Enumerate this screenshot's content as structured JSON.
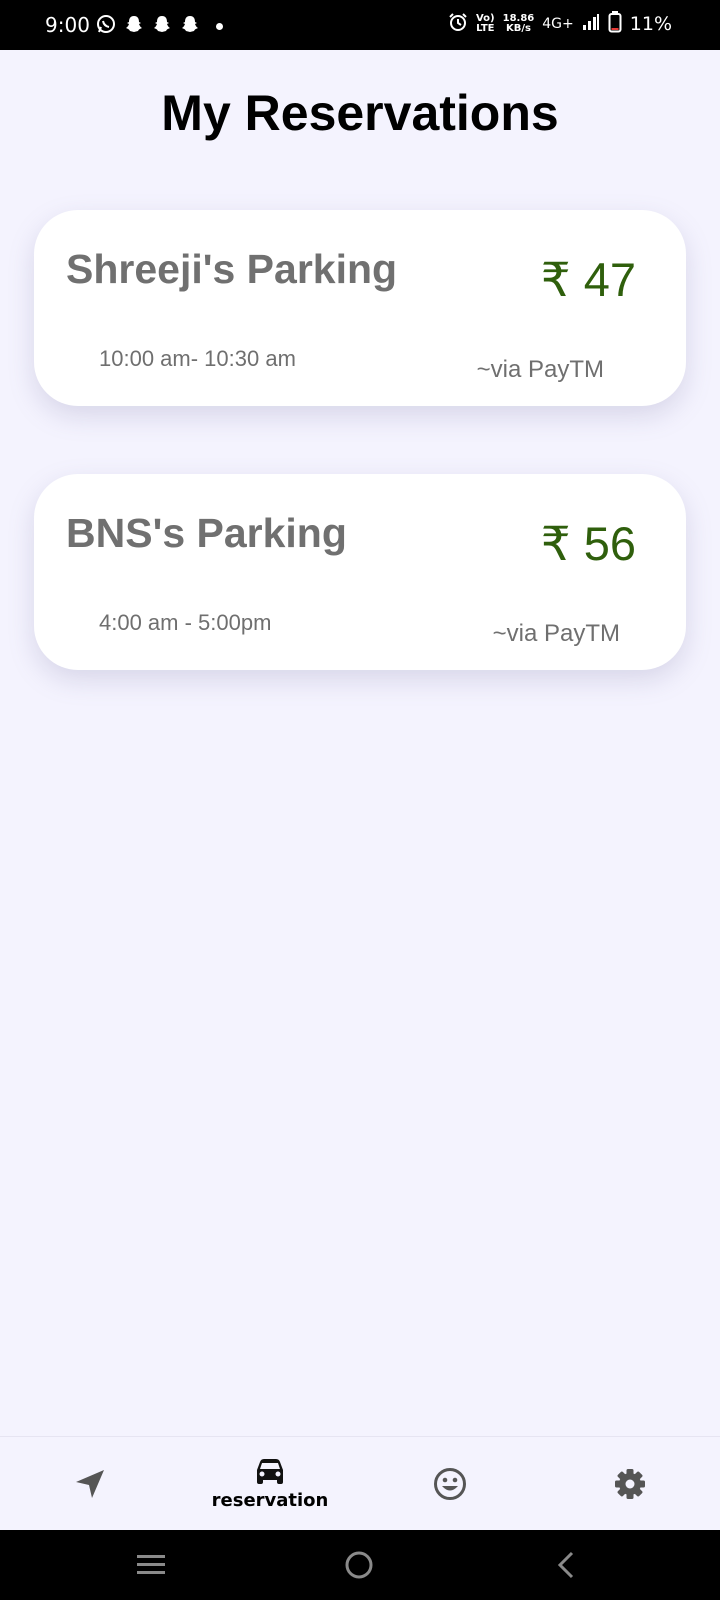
{
  "status_bar": {
    "time": "9:00",
    "network_top": "Vo)",
    "network_bottom": "LTE",
    "speed_value": "18.86",
    "speed_unit": "KB/s",
    "network_type": "4G+",
    "battery_percent": "11%"
  },
  "page": {
    "title": "My Reservations"
  },
  "reservations": [
    {
      "name": "Shreeji's Parking",
      "price": "₹ 47",
      "time": "10:00 am- 10:30 am",
      "payment": "~via PayTM"
    },
    {
      "name": "BNS's Parking",
      "price": "₹ 56",
      "time": "4:00 am - 5:00pm",
      "payment": "~via PayTM"
    }
  ],
  "bottom_nav": {
    "items": [
      {
        "icon": "navigation-arrow-icon",
        "label": ""
      },
      {
        "icon": "car-icon",
        "label": "reservation",
        "active": true
      },
      {
        "icon": "smiley-icon",
        "label": ""
      },
      {
        "icon": "gear-icon",
        "label": ""
      }
    ]
  },
  "colors": {
    "background": "#f4f3fe",
    "price_green": "#2f5f0c",
    "card": "#ffffff",
    "muted_text": "#707070"
  }
}
